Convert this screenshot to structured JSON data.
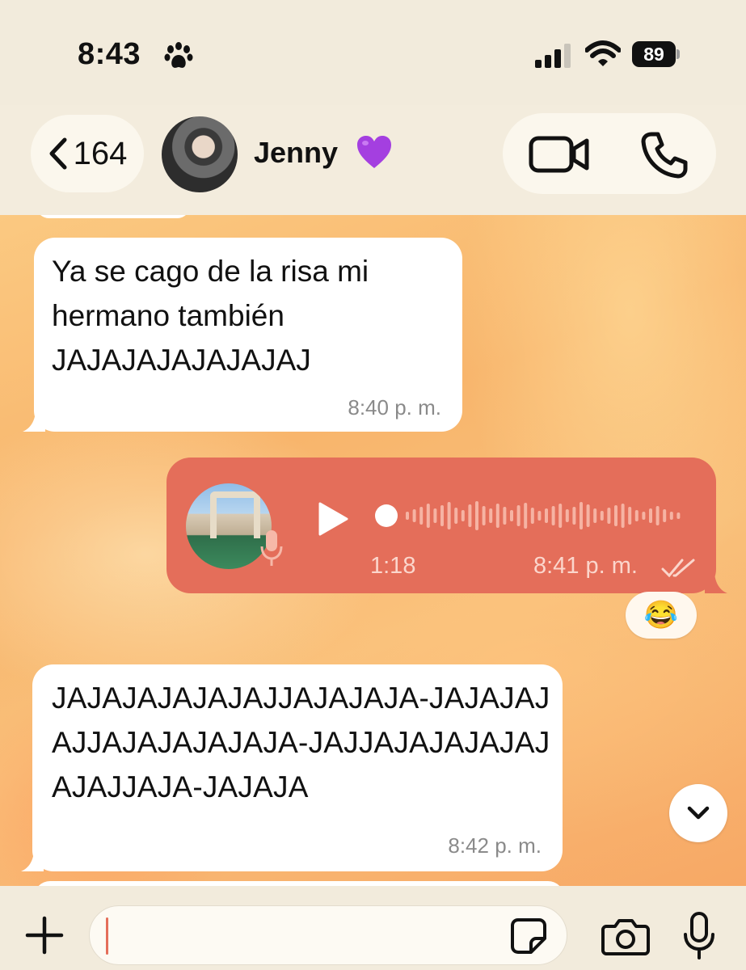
{
  "status_bar": {
    "time": "8:43",
    "battery": "89"
  },
  "header": {
    "back_count": "164",
    "contact_name": "Jenny"
  },
  "messages": [
    {
      "direction": "incoming",
      "text": "Ya se cago de la risa mi hermano también JAJAJAJAJAJAJAJ",
      "time": "8:40 p. m."
    },
    {
      "direction": "outgoing",
      "type": "voice",
      "duration": "1:18",
      "time": "8:41 p. m.",
      "reaction": "😂"
    },
    {
      "direction": "incoming",
      "text": "JAJAJAJAJAJAJJAJAJAJA-JAJAJAJAJJAJAJAJAJAJA-JAJJAJAJAJAJAJAJAJJAJA-JAJAJA",
      "time": "8:42 p. m."
    }
  ],
  "input": {
    "placeholder": "",
    "value": ""
  },
  "colors": {
    "outgoing_bubble": "#e46e5a",
    "incoming_bubble": "#ffffff",
    "chrome_bg": "#f3ecdd",
    "heart": "#a43fe0"
  },
  "icons": [
    "paw-icon",
    "signal-icon",
    "wifi-icon",
    "chevron-left-icon",
    "purple-heart-icon",
    "video-call-icon",
    "phone-icon",
    "microphone-icon",
    "play-icon",
    "double-check-icon",
    "chevron-down-icon",
    "plus-icon",
    "sticker-icon",
    "camera-icon"
  ]
}
